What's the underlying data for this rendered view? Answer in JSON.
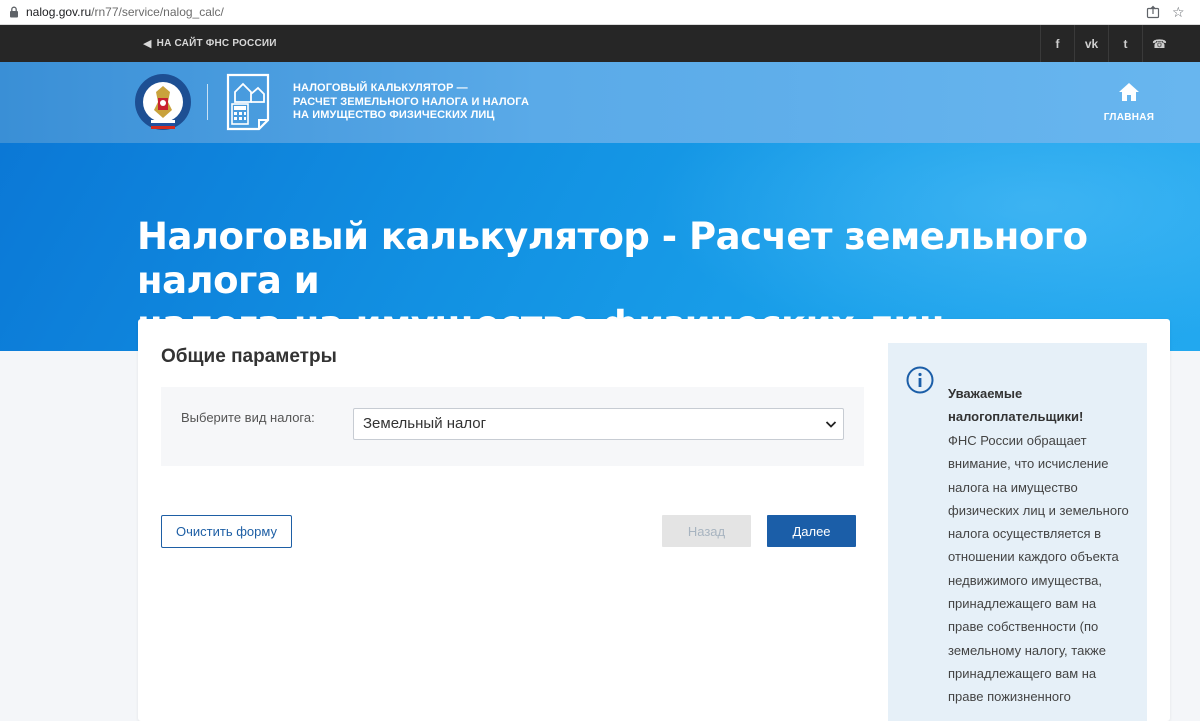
{
  "browser": {
    "url_host": "nalog.gov.ru",
    "url_path": "/rn77/service/nalog_calc/"
  },
  "topbar": {
    "back_link": "НА САЙТ ФНС РОССИИ",
    "social": [
      {
        "name": "facebook-icon",
        "glyph": "f"
      },
      {
        "name": "vk-icon",
        "glyph": "vk"
      },
      {
        "name": "twitter-icon",
        "glyph": "t"
      },
      {
        "name": "phone-icon",
        "glyph": "☎"
      }
    ]
  },
  "header": {
    "title_line1": "НАЛОГОВЫЙ КАЛЬКУЛЯТОР —",
    "title_line2": "РАСЧЕТ ЗЕМЕЛЬНОГО НАЛОГА И НАЛОГА",
    "title_line3": "НА ИМУЩЕСТВО ФИЗИЧЕСКИХ ЛИЦ",
    "home_label": "ГЛАВНАЯ"
  },
  "hero": {
    "title_line1": "Налоговый калькулятор - Расчет земельного налога и",
    "title_line2": "налога на имущество физических лиц"
  },
  "form": {
    "section_title": "Общие параметры",
    "tax_type_label": "Выберите вид налога:",
    "tax_type_value": "Земельный налог",
    "clear_label": "Очистить форму",
    "back_label": "Назад",
    "next_label": "Далее"
  },
  "info": {
    "title": "Уважаемые налогоплательщики!",
    "text": "ФНС России обращает внимание, что исчисление налога на имущество физических лиц и земельного налога осуществляется в отношении каждого объекта недвижимого имущества, принадлежащего вам на праве собственности (по земельному налогу, также принадлежащего вам на праве пожизненного"
  },
  "colors": {
    "primary": "#1b5ea8",
    "topbar": "#262626",
    "hero": "#1291e2",
    "info_bg": "#e6f0f8"
  }
}
